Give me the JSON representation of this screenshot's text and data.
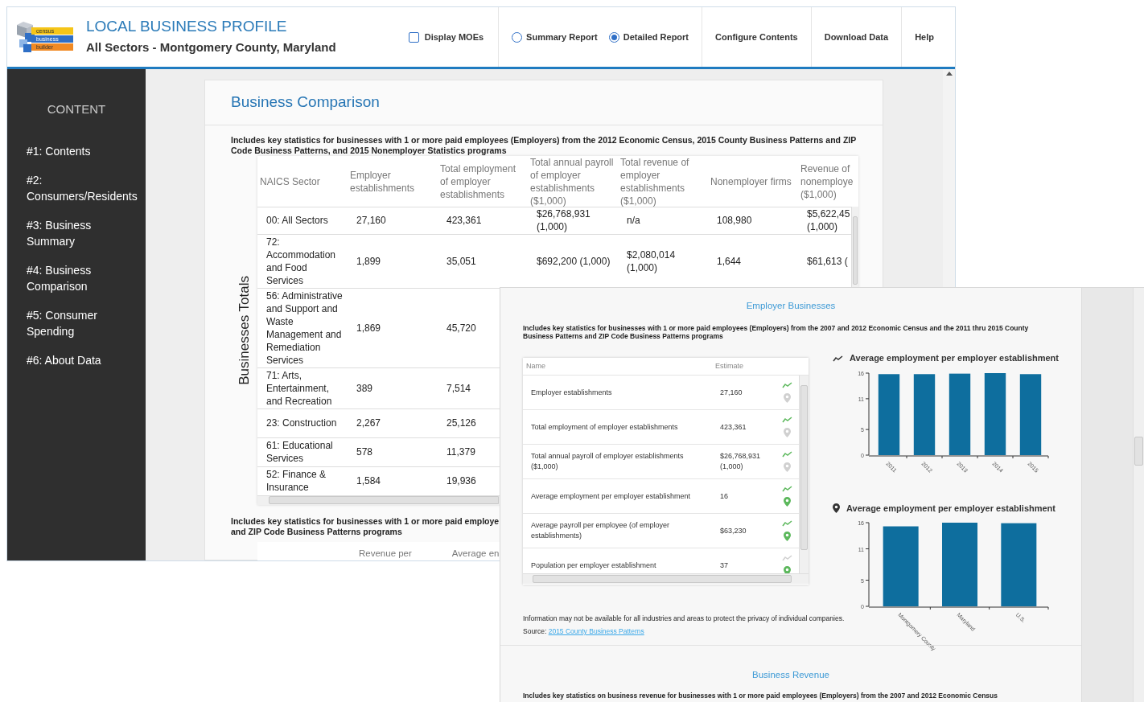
{
  "header": {
    "logo_words": [
      "census",
      "business",
      "builder"
    ],
    "title": "LOCAL BUSINESS PROFILE",
    "subtitle": "All Sectors - Montgomery County, Maryland",
    "moe_toggle": {
      "label": "Display MOEs",
      "checked": false
    },
    "report_types": [
      {
        "label": "Summary Report",
        "selected": false
      },
      {
        "label": "Detailed Report",
        "selected": true
      }
    ],
    "links": [
      "Configure Contents",
      "Download Data",
      "Help"
    ]
  },
  "sidebar": {
    "heading": "CONTENT",
    "items": [
      "#1: Contents",
      "#2: Consumers/Residents",
      "#3: Business Summary",
      "#4: Business Comparison",
      "#5: Consumer Spending",
      "#6: About Data"
    ]
  },
  "comparison": {
    "title": "Business Comparison",
    "intro": "Includes key statistics for businesses with 1 or more paid employees (Employers) from the 2012 Economic Census, 2015 County Business Patterns and ZIP Code Business Patterns, and 2015 Nonemployer Statistics programs",
    "side_label": "Businesses Totals",
    "columns": [
      "NAICS Sector",
      "Employer establishments",
      "Total employment of employer establishments",
      "Total annual payroll of employer establishments ($1,000)",
      "Total revenue of employer establishments ($1,000)",
      "Nonemployer firms",
      "Revenue of nonemploye ($1,000)"
    ],
    "rows": [
      [
        "00: All Sectors",
        "27,160",
        "423,361",
        "$26,768,931 (1,000)",
        "n/a",
        "108,980",
        "$5,622,45 (1,000)"
      ],
      [
        "72: Accommodation and Food Services",
        "1,899",
        "35,051",
        "$692,200 (1,000)",
        "$2,080,014 (1,000)",
        "1,644",
        "$61,613 ("
      ],
      [
        "56: Administrative and Support and Waste Management and Remediation Services",
        "1,869",
        "45,720"
      ],
      [
        "71: Arts, Entertainment, and Recreation",
        "389",
        "7,514"
      ],
      [
        "23: Construction",
        "2,267",
        "25,126"
      ],
      [
        "61: Educational Services",
        "578",
        "11,379"
      ],
      [
        "52: Finance & Insurance",
        "1,584",
        "19,936"
      ]
    ],
    "second_intro_lines": [
      "Includes key statistics for businesses with 1 or more paid employe",
      "and ZIP Code Business Patterns programs"
    ],
    "second_columns": [
      "Revenue per",
      "Average en"
    ]
  },
  "employer_panel": {
    "title": "Employer Businesses",
    "intro": "Includes key statistics for businesses with 1 or more paid employees (Employers) from the 2007 and 2012 Economic Census and the 2011 thru 2015 County Business Patterns and ZIP Code Business Patterns programs",
    "columns": [
      "Name",
      "Estimate"
    ],
    "rows": [
      {
        "name": "Employer establishments",
        "estimate": "27,160",
        "trend": true,
        "map": false
      },
      {
        "name": "Total employment of employer establishments",
        "estimate": "423,361",
        "trend": true,
        "map": false
      },
      {
        "name": "Total annual payroll of employer establishments ($1,000)",
        "estimate": "$26,768,931 (1,000)",
        "trend": true,
        "map": false
      },
      {
        "name": "Average employment per employer establishment",
        "estimate": "16",
        "trend": true,
        "map": true
      },
      {
        "name": "Average payroll per employee (of employer establishments)",
        "estimate": "$63,230",
        "trend": true,
        "map": true
      },
      {
        "name": "Population per employer establishment",
        "estimate": "37",
        "trend": false,
        "map": true
      }
    ],
    "charts": [
      {
        "kind": "trend",
        "chart_data": {
          "type": "bar",
          "title": "Average employment per employer establishment",
          "categories": [
            "2011",
            "2012",
            "2013",
            "2014",
            "2015"
          ],
          "series": [
            {
              "color": "#0e6e9e",
              "values": [
                15.8,
                15.8,
                15.9,
                16,
                15.8
              ]
            }
          ],
          "ylim": [
            0,
            16
          ],
          "yticks": [
            0,
            5,
            11,
            16
          ]
        }
      },
      {
        "kind": "map",
        "chart_data": {
          "type": "bar",
          "title": "Average employment per employer establishment",
          "categories": [
            "Montgomery County",
            "Maryland",
            "U.S."
          ],
          "series": [
            {
              "color": "#0e6e9e",
              "values": [
                15.3,
                16,
                15.9
              ]
            }
          ],
          "ylim": [
            0,
            16
          ],
          "yticks": [
            0,
            5,
            11,
            16
          ]
        }
      }
    ],
    "note": "Information may not be available for all industries and areas to protect the privacy of individual companies.",
    "source_label": "Source:",
    "source_link": "2015 County Business Patterns"
  },
  "revenue_panel": {
    "title": "Business Revenue",
    "intro": "Includes key statistics on business revenue for businesses with 1 or more paid employees (Employers) from the 2007 and 2012 Economic Census"
  }
}
